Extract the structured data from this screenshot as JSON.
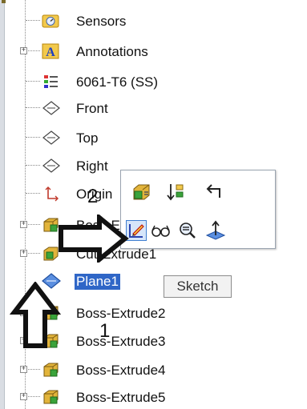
{
  "tree": {
    "items": [
      {
        "label": "Sensors",
        "icon": "sensors-folder-icon",
        "expandable": false
      },
      {
        "label": "Annotations",
        "icon": "annotations-icon",
        "expandable": true,
        "expander": "+"
      },
      {
        "label": "6061-T6 (SS)",
        "icon": "material-icon",
        "expandable": false
      },
      {
        "label": "Front",
        "icon": "plane-icon",
        "expandable": false
      },
      {
        "label": "Top",
        "icon": "plane-icon",
        "expandable": false
      },
      {
        "label": "Right",
        "icon": "plane-icon",
        "expandable": false
      },
      {
        "label": "Origin",
        "icon": "origin-icon",
        "expandable": false
      },
      {
        "label": "Boss-Extrude1",
        "icon": "extrude-icon",
        "expandable": true,
        "expander": "+"
      },
      {
        "label": "Cut-Extrude1",
        "icon": "extrude-icon",
        "expandable": true,
        "expander": "+"
      },
      {
        "label": "Plane1",
        "icon": "plane-icon",
        "expandable": false,
        "selected": true
      },
      {
        "label": "Boss-Extrude2",
        "icon": "extrude-icon",
        "expandable": true,
        "expander": "+"
      },
      {
        "label": "Boss-Extrude3",
        "icon": "extrude-icon",
        "expandable": true,
        "expander": "+"
      },
      {
        "label": "Boss-Extrude4",
        "icon": "extrude-icon",
        "expandable": true,
        "expander": "+"
      },
      {
        "label": "Boss-Extrude5",
        "icon": "extrude-icon",
        "expandable": true,
        "expander": "+"
      }
    ]
  },
  "context_toolbar": {
    "row1": [
      "feature-properties-icon",
      "rollback-icon",
      "exit-arrow-icon"
    ],
    "row2": [
      "sketch-icon",
      "view-glasses-icon",
      "zoom-to-selection-icon",
      "normal-to-icon"
    ],
    "active_tool": "sketch-icon"
  },
  "tooltip": {
    "text": "Sketch"
  },
  "annotations": {
    "step1": "1",
    "step2": "2"
  },
  "colors": {
    "selection": "#2f66c7",
    "folder_yellow": "#f2c94c",
    "extrude_green": "#3aa33a"
  }
}
